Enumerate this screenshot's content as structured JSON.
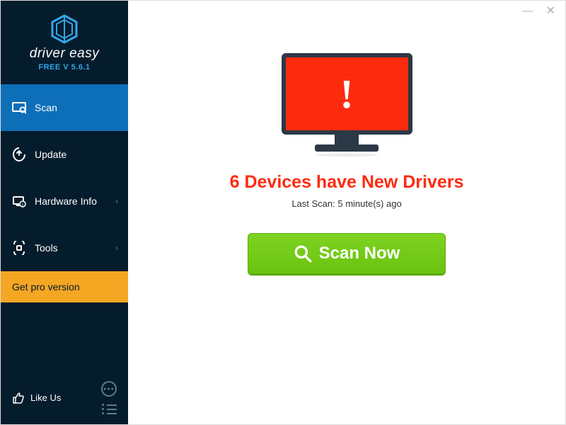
{
  "brand": "driver easy",
  "version": "FREE V 5.6.1",
  "titlebar": {
    "minimize": "—",
    "close": "✕"
  },
  "nav": {
    "scan": "Scan",
    "update": "Update",
    "hardware": "Hardware Info",
    "tools": "Tools"
  },
  "get_pro": "Get pro version",
  "like_us": "Like Us",
  "main": {
    "headline": "6 Devices have New Drivers",
    "last_scan": "Last Scan: 5 minute(s) ago",
    "scan_button": "Scan Now",
    "exclaim": "!"
  }
}
